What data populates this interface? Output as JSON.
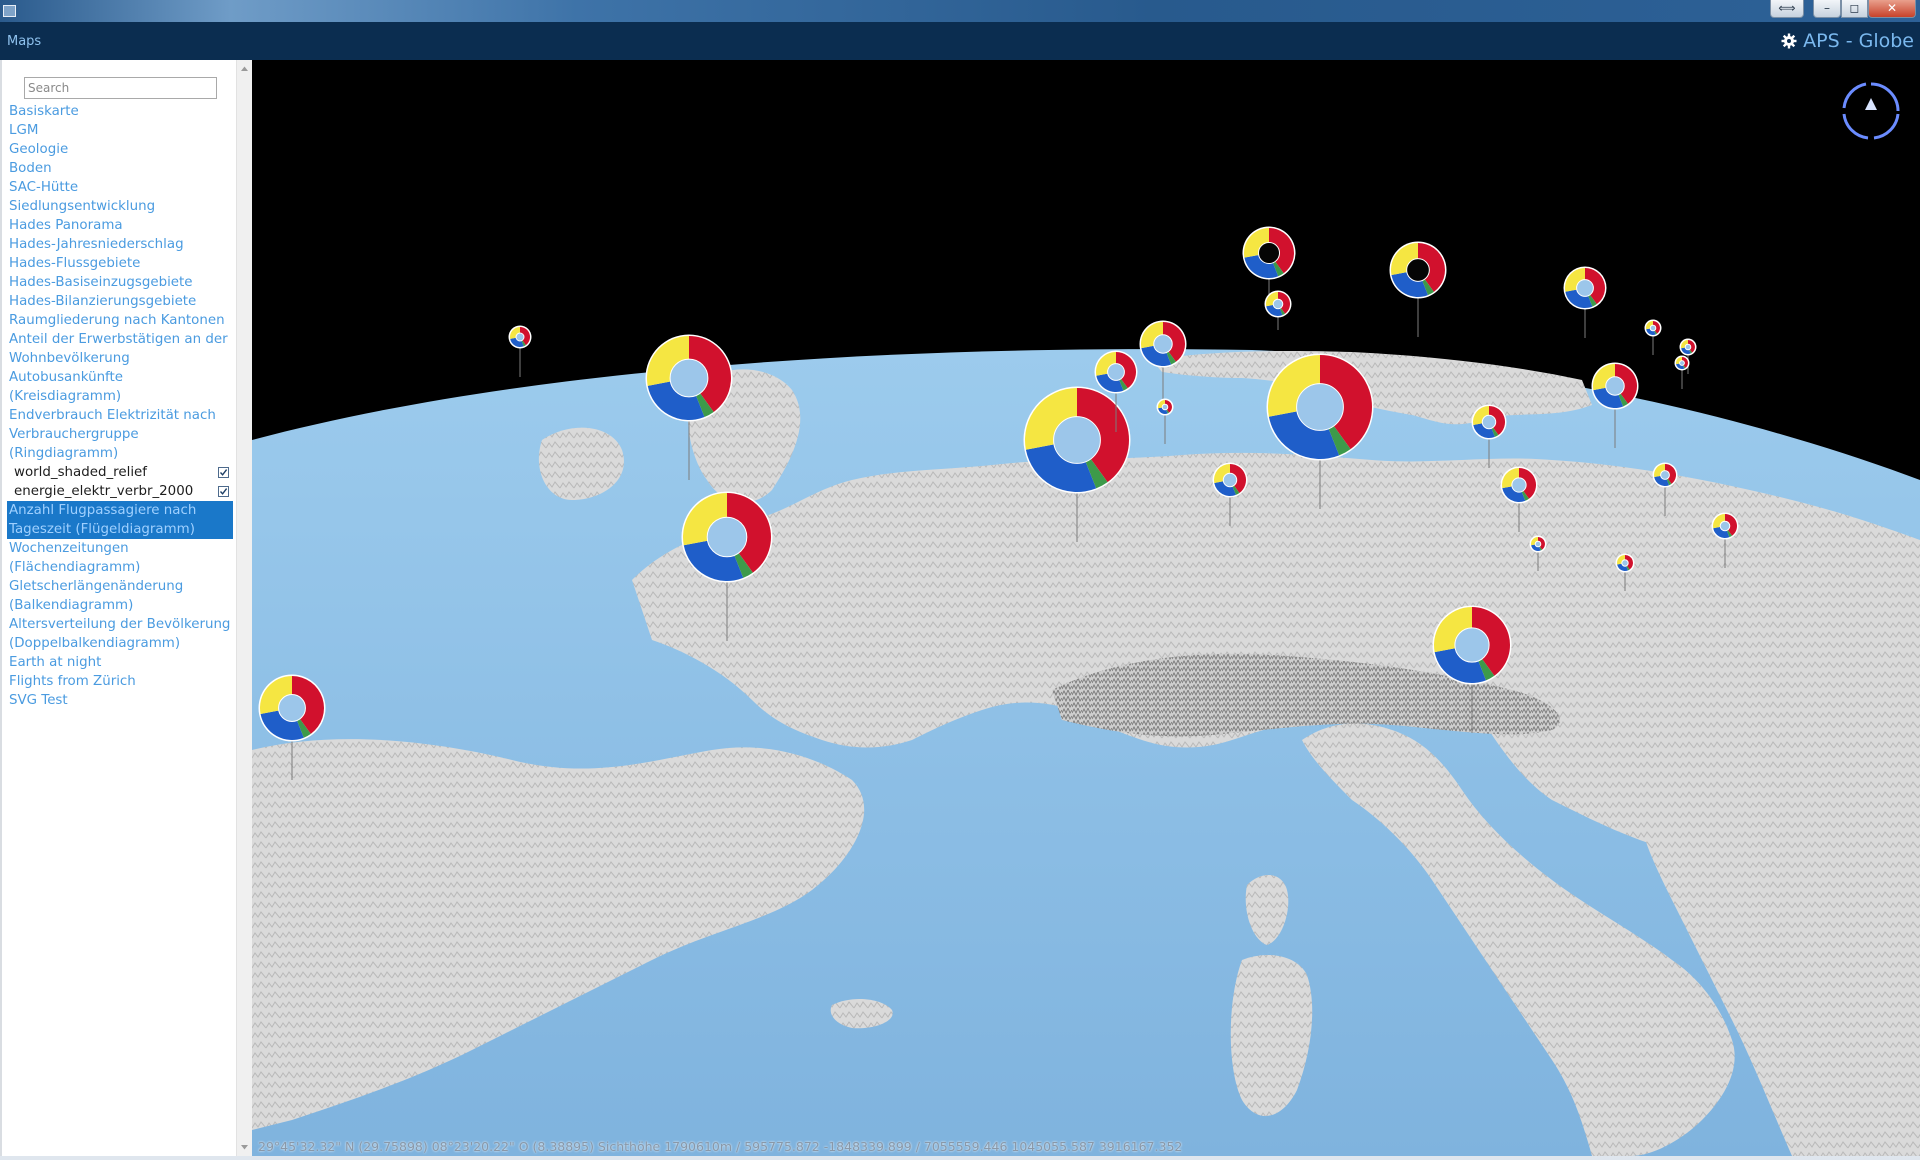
{
  "window": {
    "resize_label": "⟺",
    "minimize_label": "–",
    "maximize_label": "◻",
    "close_label": "✕"
  },
  "app": {
    "title": "Maps",
    "brand": "APS - Globe"
  },
  "search": {
    "placeholder": "Search"
  },
  "layers": {
    "basiskarte": "Basiskarte",
    "lgm": "LGM",
    "geologie": "Geologie",
    "boden": "Boden",
    "sac_huette": "SAC-Hütte",
    "siedlungsentwicklung": "Siedlungsentwicklung",
    "hades_panorama": "Hades Panorama",
    "hades_jahresniederschlag": "Hades-Jahresniederschlag",
    "hades_flussgebiete": "Hades-Flussgebiete",
    "hades_basiseinzugsgebiete": "Hades-Basiseinzugsgebiete",
    "hades_bilanzierungsgebiete": "Hades-Bilanzierungsgebiete",
    "raumgliederung": "Raumgliederung nach Kantonen",
    "anteil_erwerbstaetige": "Anteil der Erwerbstätigen an der Wohnbevölkerung",
    "autobusankuenfte": "Autobusankünfte (Kreisdiagramm)",
    "endverbrauch": "Endverbrauch Elektrizität nach Verbrauchergruppe (Ringdiagramm)",
    "sub_world_shaded_relief": "world_shaded_relief",
    "sub_energie_elektr": "energie_elektr_verbr_2000",
    "anzahl_flugpassagiere": "Anzahl Flugpassagiere nach Tageszeit (Flügeldiagramm)",
    "wochenzeitungen": "Wochenzeitungen (Flächendiagramm)",
    "gletscherlaengen": "Gletscherlängenänderung (Balkendiagramm)",
    "altersverteilung": "Altersverteilung der Bevölkerung (Doppelbalkendiagramm)",
    "earth_at_night": "Earth at night",
    "flights_from_zuerich": "Flights from Zürich",
    "svg_test": "SVG Test"
  },
  "status": {
    "coordinates": "29°45'32.32\" N (29.75898) 08°23'20.22\" O (8.38895) Sichthöhe 1790610m / 595775.872 -1848339.899 / 7055559.446 1045055.587 3916167.352"
  },
  "colors": {
    "segment_yellow": "#f5e642",
    "segment_red": "#d1112d",
    "segment_blue": "#1f5ec9",
    "segment_green": "#3d9a4a",
    "ocean": "#8cbfe6",
    "land": "#dcdcdc",
    "space": "#000000",
    "accent": "#4a9be0"
  },
  "icons": {
    "brand": "gear-icon",
    "compass": "compass-icon",
    "checkbox": "check-icon"
  }
}
